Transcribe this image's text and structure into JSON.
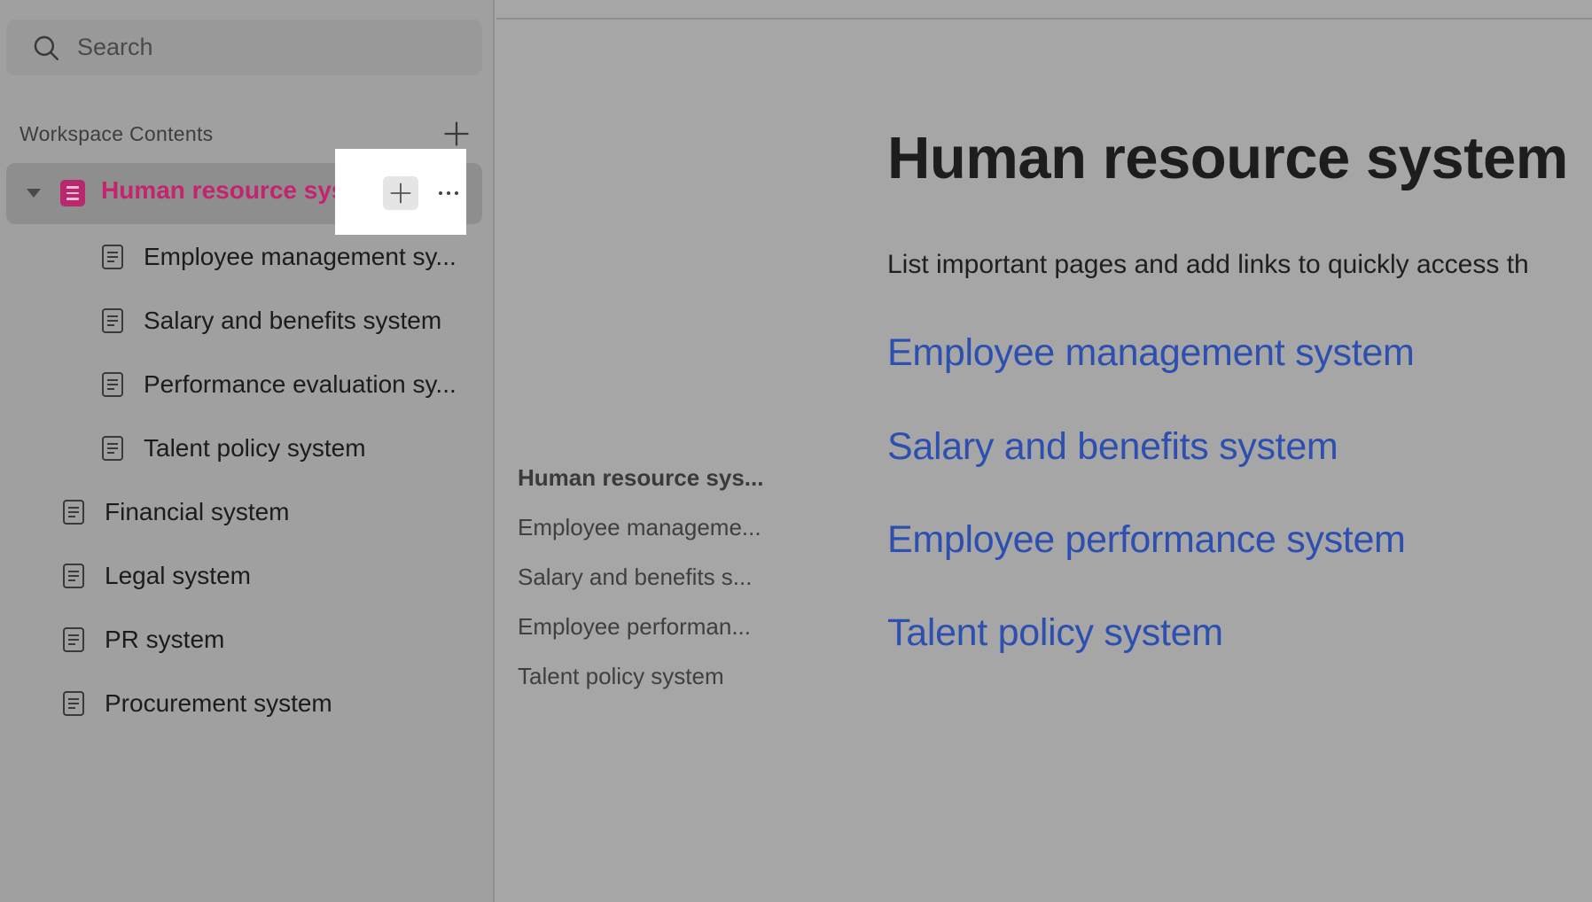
{
  "search": {
    "placeholder": "Search",
    "icon": "search-icon"
  },
  "workspace": {
    "title": "Workspace Contents",
    "add_icon": "plus-icon"
  },
  "tree": {
    "active": {
      "label": "Human resource system",
      "color": "#c4246e",
      "icon": "document-icon"
    },
    "children": [
      {
        "label": "Employee management sy..."
      },
      {
        "label": "Salary and benefits system"
      },
      {
        "label": "Performance evaluation sy..."
      },
      {
        "label": "Talent policy system"
      }
    ],
    "items": [
      {
        "label": "Financial system"
      },
      {
        "label": "Legal system"
      },
      {
        "label": "PR system"
      },
      {
        "label": "Procurement system"
      }
    ]
  },
  "toc": [
    "Human resource sys...",
    "Employee manageme...",
    "Salary and benefits s...",
    "Employee performan...",
    "Talent policy system"
  ],
  "page": {
    "title": "Human resource system",
    "description": "List important pages and add links to quickly access th",
    "links": [
      "Employee management system",
      "Salary and benefits system",
      "Employee performance system",
      "Talent policy system"
    ],
    "link_color": "#2d4fb0"
  }
}
